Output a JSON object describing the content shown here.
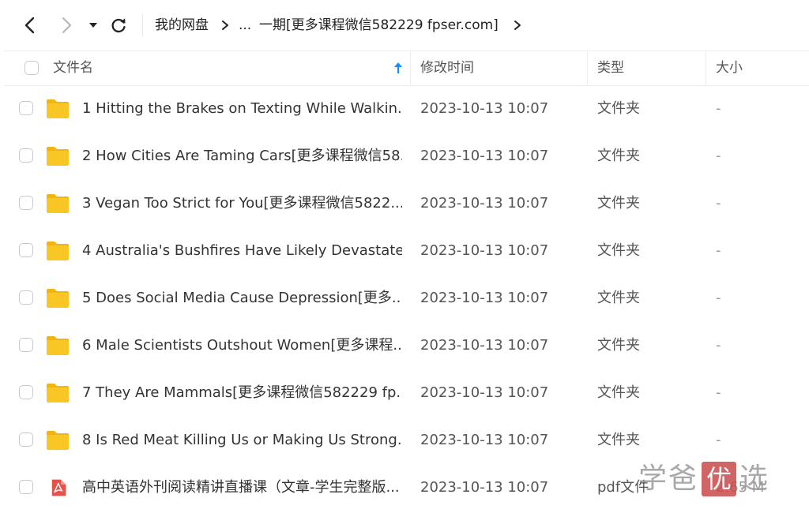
{
  "breadcrumb": {
    "root": "我的网盘",
    "ellipsis": "...",
    "current": "一期[更多课程微信582229 fpser.com]"
  },
  "table": {
    "headers": {
      "name": "文件名",
      "modified": "修改时间",
      "type": "类型",
      "size": "大小"
    },
    "sort": {
      "column": "name",
      "direction": "ascending"
    },
    "rows": [
      {
        "name": "1 Hitting the Brakes on Texting While Walkin...",
        "modified": "2023-10-13 10:07",
        "type": "文件夹",
        "size": "-",
        "icon": "folder-icon"
      },
      {
        "name": "2 How Cities Are Taming Cars[更多课程微信58...",
        "modified": "2023-10-13 10:07",
        "type": "文件夹",
        "size": "-",
        "icon": "folder-icon"
      },
      {
        "name": "3 Vegan Too Strict for You[更多课程微信5822...",
        "modified": "2023-10-13 10:07",
        "type": "文件夹",
        "size": "-",
        "icon": "folder-icon"
      },
      {
        "name": "4 Australia's Bushfires Have Likely Devastate...",
        "modified": "2023-10-13 10:07",
        "type": "文件夹",
        "size": "-",
        "icon": "folder-icon"
      },
      {
        "name": "5 Does Social Media Cause Depression[更多...",
        "modified": "2023-10-13 10:07",
        "type": "文件夹",
        "size": "-",
        "icon": "folder-icon"
      },
      {
        "name": "6 Male Scientists Outshout Women[更多课程...",
        "modified": "2023-10-13 10:07",
        "type": "文件夹",
        "size": "-",
        "icon": "folder-icon"
      },
      {
        "name": "7 They Are Mammals[更多课程微信582229 fp...",
        "modified": "2023-10-13 10:07",
        "type": "文件夹",
        "size": "-",
        "icon": "folder-icon"
      },
      {
        "name": "8 Is Red Meat Killing Us or Making Us Strong...",
        "modified": "2023-10-13 10:07",
        "type": "文件夹",
        "size": "-",
        "icon": "folder-icon"
      },
      {
        "name": "高中英语外刊阅读精讲直播课（文章-学生完整版...",
        "modified": "2023-10-13 10:07",
        "type": "pdf文件",
        "size": "2.65 M",
        "icon": "pdf-icon"
      }
    ]
  },
  "watermark": {
    "chars": [
      "学",
      "爸",
      "优",
      "选"
    ]
  },
  "colors": {
    "folder": "#f8c625",
    "folder_tab": "#f0b513",
    "pdf": "#e8514a",
    "sort_arrow": "#1a8cff",
    "stamp": "#c94a4a"
  }
}
